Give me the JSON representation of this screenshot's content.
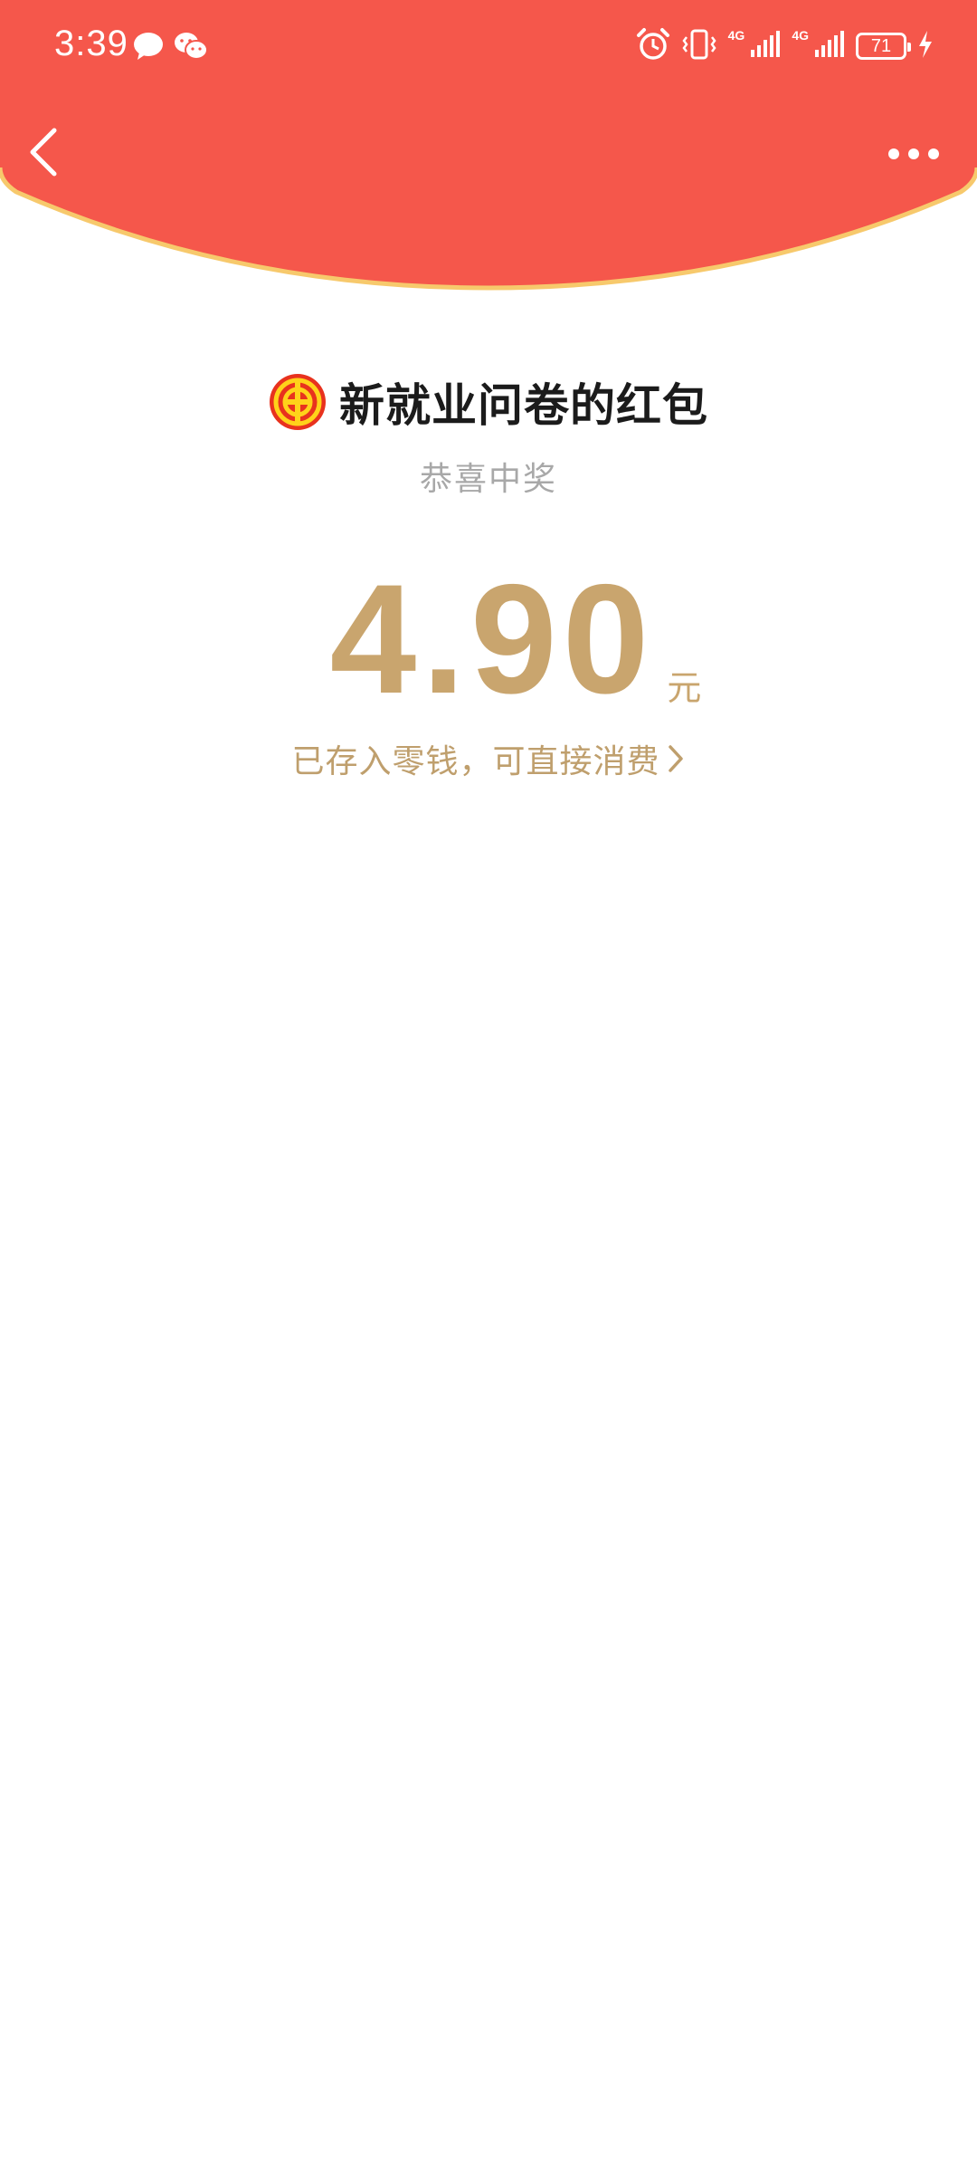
{
  "status_bar": {
    "time": "3:39",
    "network_1": "4G",
    "network_2": "4G",
    "battery_level": "71"
  },
  "nav": {
    "back_icon": "chevron-left-icon",
    "more_icon": "more-dots-icon"
  },
  "colors": {
    "header_red": "#f5574b",
    "header_rim": "#f7c96c",
    "gold": "#c9a56e",
    "gray_text": "#a8a8a8"
  },
  "red_packet": {
    "sender_name": "新就业问卷的红包",
    "greeting": "恭喜中奖",
    "amount": "4.90",
    "unit": "元",
    "saved_text": "已存入零钱，可直接消费"
  }
}
